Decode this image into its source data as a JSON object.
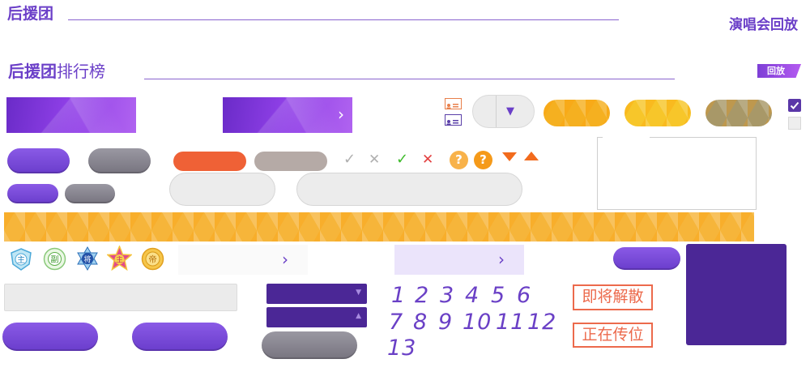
{
  "colors": {
    "accent": "#6b3fc8",
    "dark_purple": "#4b2796",
    "orange": "#ef6136",
    "gold": "#f5b020"
  },
  "header": {
    "title": "后援团",
    "title_icon": "line-divider",
    "top_right_link": "演唱会回放"
  },
  "ranking": {
    "title_bold": "后援团",
    "title_rest": "排行榜",
    "replay_tag": "回放"
  },
  "checks": {
    "gray_check": "✓",
    "gray_cross": "✕",
    "green_check": "✓",
    "red_cross": "✕",
    "question": "?"
  },
  "badges": [
    {
      "label": "主",
      "icon": "shield-badge-icon"
    },
    {
      "label": "副",
      "icon": "circle-badge-icon"
    },
    {
      "label": "将",
      "icon": "star-of-david-badge-icon"
    },
    {
      "label": "主",
      "icon": "star-badge-icon"
    },
    {
      "label": "帝",
      "icon": "gold-coin-badge-icon"
    }
  ],
  "numbers_row1": [
    "1",
    "2",
    "3",
    "4",
    "5",
    "6"
  ],
  "numbers_row2": [
    "7",
    "8",
    "9",
    "10",
    "11",
    "12"
  ],
  "numbers_row3": [
    "13"
  ],
  "status_tags": {
    "dissolve": "即将解散",
    "transfer": "正在传位"
  },
  "icons": {
    "chevron": "›",
    "caret_down": "▼",
    "caret_up": "▲"
  }
}
